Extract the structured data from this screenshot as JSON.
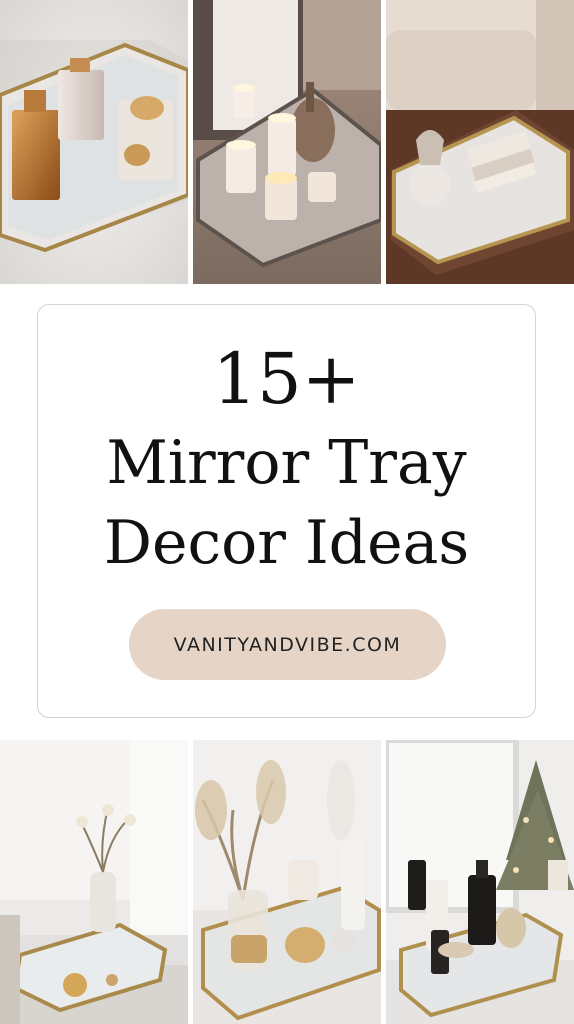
{
  "title": {
    "line1": "15+",
    "line2": "Mirror Tray",
    "line3": "Decor Ideas"
  },
  "website": "VANITYANDVIBE.COM",
  "colors": {
    "pill_bg": "#e6d5c7",
    "text": "#111111",
    "card_border": "#d6d3d0"
  }
}
